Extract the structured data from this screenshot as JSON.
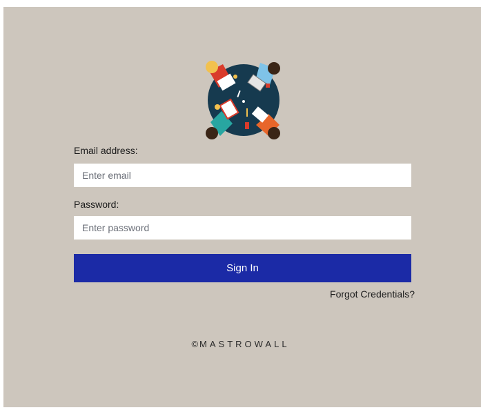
{
  "logo": {
    "icon": "team-meeting-table-icon",
    "colors": {
      "table": "#163a4f",
      "person_orange": "#e8662a",
      "person_teal": "#28a6a1",
      "person_red": "#d93b2b",
      "hair_blonde": "#f2c14e",
      "hair_dark": "#3a2516",
      "shirt_blue": "#7fc3e8"
    }
  },
  "form": {
    "email_label": "Email address:",
    "email_placeholder": "Enter email",
    "email_value": "",
    "password_label": "Password:",
    "password_placeholder": "Enter password",
    "password_value": "",
    "signin_label": "Sign In",
    "forgot_label": "Forgot Credentials?"
  },
  "footer": {
    "copyright_symbol": "©",
    "brand": "MASTROWALL"
  },
  "colors": {
    "background": "#cdc6bd",
    "primary_button": "#1b2aa6",
    "input_bg": "#ffffff"
  }
}
